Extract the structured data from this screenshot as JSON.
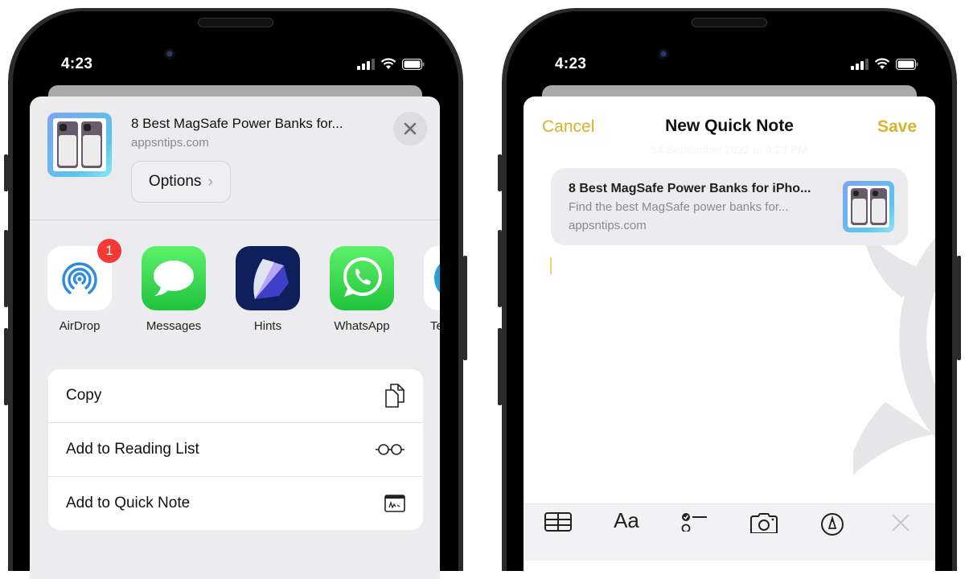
{
  "left_phone": {
    "status_time": "4:23",
    "share_sheet": {
      "title": "8 Best MagSafe Power Banks for...",
      "domain": "appsntips.com",
      "options_label": "Options",
      "apps": [
        {
          "label": "AirDrop",
          "icon": "airdrop-icon",
          "badge": "1"
        },
        {
          "label": "Messages",
          "icon": "messages-icon"
        },
        {
          "label": "Hints",
          "icon": "hints-icon"
        },
        {
          "label": "WhatsApp",
          "icon": "whatsapp-icon"
        },
        {
          "label": "Te",
          "icon": "telegram-icon"
        }
      ],
      "actions": [
        {
          "label": "Copy",
          "icon": "copy-icon"
        },
        {
          "label": "Add to Reading List",
          "icon": "glasses-icon"
        },
        {
          "label": "Add to Quick Note",
          "icon": "quick-note-icon"
        }
      ]
    }
  },
  "right_phone": {
    "status_time": "4:23",
    "quick_note": {
      "cancel_label": "Cancel",
      "title": "New Quick Note",
      "save_label": "Save",
      "date": "14 September 2022 at 4:23 PM",
      "link_card": {
        "title": "8 Best MagSafe Power Banks for iPho...",
        "description": "Find the best MagSafe power banks for...",
        "domain": "appsntips.com"
      },
      "toolbar": [
        {
          "icon": "table-icon"
        },
        {
          "icon": "text-format-icon",
          "label": "Aa"
        },
        {
          "icon": "checklist-icon"
        },
        {
          "icon": "camera-icon"
        },
        {
          "icon": "markup-icon"
        },
        {
          "icon": "close-icon"
        }
      ]
    }
  },
  "colors": {
    "accent_gold": "#d9b12a",
    "badge_red": "#f03a33",
    "sheet_bg": "#ececef"
  }
}
